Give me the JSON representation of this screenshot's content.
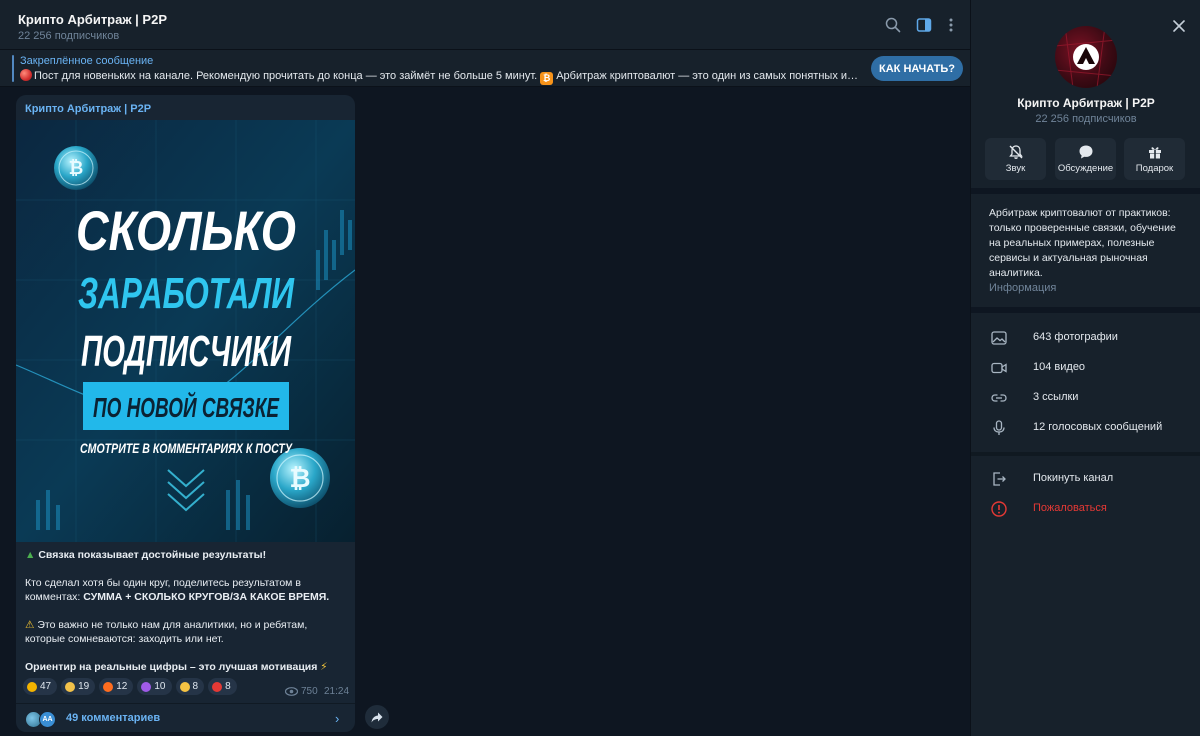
{
  "header": {
    "title": "Крипто Арбитраж | P2P",
    "subscribers": "22 256 подписчиков"
  },
  "pinned": {
    "label": "Закреплённое сообщение",
    "text_part1": "Пост для новеньких на канале. Рекомендую прочитать до конца — это займёт не больше 5 минут.",
    "text_part2": "Арбитраж криптовалют — это один из самых понятных и быст...",
    "button": "КАК НАЧАТЬ?"
  },
  "message": {
    "author": "Крипто Арбитраж | P2P",
    "poster": {
      "line1": "СКОЛЬКО",
      "line2": "ЗАРАБОТАЛИ",
      "line3": "ПОДПИСЧИКИ",
      "line4": "ПО НОВОЙ СВЯЗКЕ",
      "line5": "СМОТРИТЕ В КОММЕНТАРИЯХ К ПОСТУ"
    },
    "p1": "Связка показывает достойные результаты!",
    "p2_plain": "Кто сделал хотя бы один круг, поделитесь результатом в комментах: ",
    "p2_bold": "СУММА + СКОЛЬКО КРУГОВ/ЗА КАКОЕ ВРЕМЯ.",
    "p3": "Это важно не только нам для аналитики, но и ребятам, которые сомневаются: заходить или нет.",
    "p4": "Ориентир на реальные цифры – это лучшая мотивация",
    "reactions": [
      {
        "icon": "thumbs-up",
        "count": "47"
      },
      {
        "icon": "ok-hand",
        "count": "19"
      },
      {
        "icon": "fire",
        "count": "12"
      },
      {
        "icon": "devil",
        "count": "10"
      },
      {
        "icon": "heart-eyes",
        "count": "8"
      },
      {
        "icon": "hundred",
        "count": "8"
      }
    ],
    "views": "750",
    "time": "21:24",
    "comments": "49 комментариев",
    "commenter_initials": "AA"
  },
  "panel": {
    "title": "Крипто Арбитраж | P2P",
    "subscribers": "22 256 подписчиков",
    "buttons": [
      {
        "label": "Звук",
        "icon": "mute-bell-icon"
      },
      {
        "label": "Обсуждение",
        "icon": "chat-bubble-icon"
      },
      {
        "label": "Подарок",
        "icon": "gift-icon"
      }
    ],
    "about": "Арбитраж криптовалют от практиков: только проверенные связки, обучение на реальных примерах, полезные сервисы и актуальная рыночная аналитика.",
    "about_label": "Информация",
    "media": [
      {
        "label": "643 фотографии",
        "icon": "photo-icon"
      },
      {
        "label": "104 видео",
        "icon": "video-icon"
      },
      {
        "label": "3 ссылки",
        "icon": "link-icon"
      },
      {
        "label": "12 голосовых сообщений",
        "icon": "mic-icon"
      }
    ],
    "leave": "Покинуть канал",
    "report": "Пожаловаться"
  },
  "colors": {
    "accent": "#6ab3f3",
    "button": "#2f6ea5",
    "danger": "#e53935",
    "bubble": "#182533",
    "panel": "#17212b"
  }
}
